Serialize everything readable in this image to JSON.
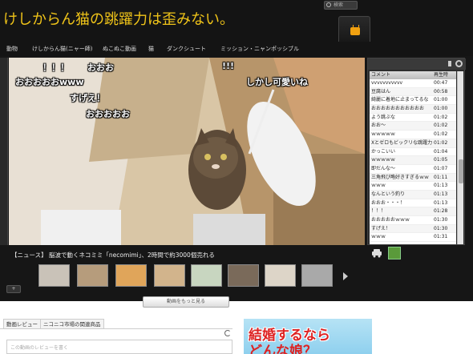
{
  "header": {
    "title": "けしからん猫の跳躍力は歪みない。",
    "search_placeholder": "検索"
  },
  "nav": [
    "動物",
    "けしからん猫(ニャー師)",
    "ぬこぬこ動画",
    "猫",
    "ダンクシュート",
    "ミッション・ニャンポッシブル"
  ],
  "overlay_comments": [
    "！！！",
    "おおお",
    "!!!",
    "おおおおおwww",
    "しかし可愛いね",
    "すげえ！",
    "おおおおお"
  ],
  "comment_list": {
    "header_comment": "コメント",
    "header_time": "再生時",
    "rows": [
      [
        "vvvvvvvvvvv",
        "00:47"
      ],
      [
        "豆腐はん",
        "00:58"
      ],
      [
        "綺麗に着地に止まってるな",
        "01:00"
      ],
      [
        "おおおおおおおおおおお",
        "01:00"
      ],
      [
        "よう跳ぶな",
        "01:02"
      ],
      [
        "おお～",
        "01:02"
      ],
      [
        "ｗｗｗｗｗ",
        "01:02"
      ],
      [
        "Xとゼロもビックリな跳躍力",
        "01:02"
      ],
      [
        "かっこいい",
        "01:04"
      ],
      [
        "ｗｗｗｗｗ",
        "01:05"
      ],
      [
        "即だんな～",
        "01:07"
      ],
      [
        "三角飛び略好きすぎるｗｗ",
        "01:11"
      ],
      [
        "ｗｗｗ",
        "01:13"
      ],
      [
        "なんという釣り",
        "01:13"
      ],
      [
        "おおお・・・！",
        "01:13"
      ],
      [
        "！！！",
        "01:28"
      ],
      [
        "おおおおおｗｗｗ",
        "01:30"
      ],
      [
        "すげえ！",
        "01:30"
      ],
      [
        "ｗｗｗ",
        "01:31"
      ]
    ]
  },
  "news": "【ニュース】 脳波で動くネコミミ「necomimi」、2時間で約3000個売れる",
  "more_button": "動画をもっと見る",
  "small_button": "+",
  "tabs": [
    "動画レビュー",
    "ニコニコ市場の関連商品"
  ],
  "review_placeholder": "この動画のレビューを書く",
  "ad": {
    "line1": "結婚するなら",
    "line2": "どんな娘？"
  },
  "colors": {
    "title": "#f0c419",
    "background": "#222222"
  }
}
